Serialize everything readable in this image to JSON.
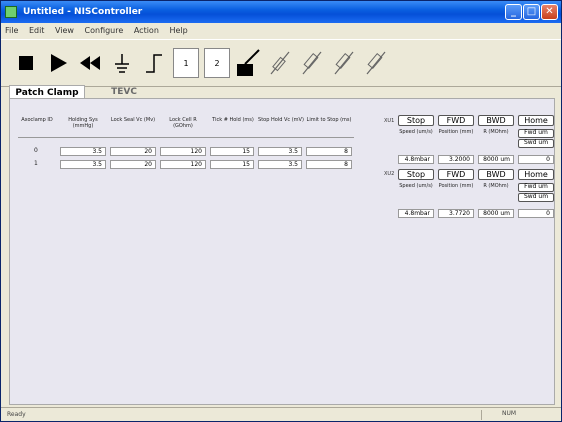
{
  "window": {
    "title": "Untitled - NISController"
  },
  "menu": [
    "File",
    "Edit",
    "View",
    "Configure",
    "Action",
    "Help"
  ],
  "toolbar": {
    "icons": [
      "stop-icon",
      "play-icon",
      "rewind-icon",
      "ground-icon",
      "step-icon",
      "slot-1",
      "slot-2",
      "electrode-icon",
      "pipette-icon",
      "pipette-icon",
      "pipette-icon",
      "pipette-icon"
    ],
    "slot1_label": "1",
    "slot2_label": "2"
  },
  "tabs": {
    "active": "Patch Clamp",
    "inactive": "TEVC"
  },
  "table": {
    "headers": [
      "Axoclamp ID",
      "Holding Sys (mmHg)",
      "Lock Seal Vc (Mv)",
      "Lock Cell R (GOhm)",
      "Tick # Hold (ms)",
      "Stop Hold Vc (mV)",
      "Limit to Stop (ms)"
    ],
    "rows": [
      {
        "id": "0",
        "values": [
          "3.5",
          "20",
          "120",
          "15",
          "3.5",
          "8"
        ]
      },
      {
        "id": "1",
        "values": [
          "3.5",
          "20",
          "120",
          "15",
          "3.5",
          "8"
        ]
      }
    ]
  },
  "manipulators": [
    {
      "tag": "XU1",
      "buttons": [
        "Stop",
        "FWD",
        "BWD",
        "Home"
      ],
      "sub_labels": [
        "Speed (um/s)",
        "Position (mm)",
        "R (MOhm)"
      ],
      "side_buttons": [
        "Fwd um",
        "Swd um"
      ],
      "values": [
        "4.8mbar",
        "3.2000",
        "8000 um",
        "0"
      ]
    },
    {
      "tag": "XU2",
      "buttons": [
        "Stop",
        "FWD",
        "BWD",
        "Home"
      ],
      "sub_labels": [
        "Speed (um/s)",
        "Position (mm)",
        "R (MOhm)"
      ],
      "side_buttons": [
        "Fwd um",
        "Swd um"
      ],
      "values": [
        "4.8mbar",
        "3.7720",
        "8000 um",
        "0"
      ]
    }
  ],
  "status": {
    "left": "Ready",
    "right": "NUM"
  }
}
